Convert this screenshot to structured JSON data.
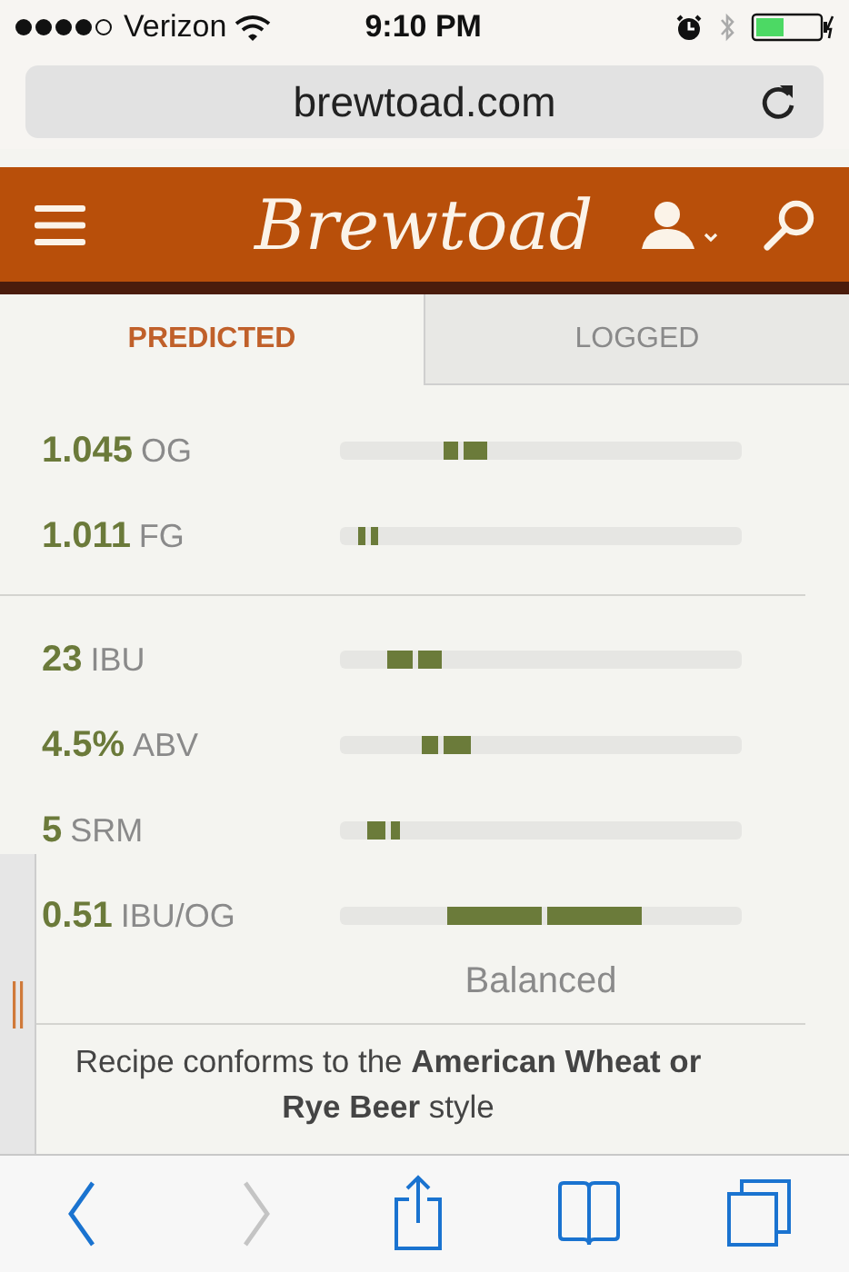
{
  "status_bar": {
    "carrier": "Verizon",
    "time": "9:10 PM"
  },
  "address_bar": {
    "url": "brewtoad.com"
  },
  "header": {
    "logo": "Brewtoad"
  },
  "tabs": [
    {
      "label": "PREDICTED",
      "selected": true
    },
    {
      "label": "LOGGED",
      "selected": false
    }
  ],
  "sections": [
    {
      "metrics": [
        {
          "value": "1.045",
          "unit": "OG",
          "low": {
            "level": 0.262
          },
          "mark": {
            "level": 0.303
          },
          "high": {
            "level": 0.362
          }
        },
        {
          "value": "1.011",
          "unit": "FG",
          "low": {
            "level": 0.05
          },
          "mark": {
            "level": 0.072
          },
          "high": {
            "level": 0.09
          }
        }
      ]
    },
    {
      "metrics": [
        {
          "value": "23",
          "unit": "IBU",
          "low": {
            "level": 0.122
          },
          "mark": {
            "level": 0.19
          },
          "high": {
            "level": 0.249
          }
        },
        {
          "value": "4.5%",
          "unit": "ABV",
          "low": {
            "level": 0.208
          },
          "mark": {
            "level": 0.249
          },
          "high": {
            "level": 0.321
          }
        },
        {
          "value": "5",
          "unit": "SRM",
          "low": {
            "level": 0.072
          },
          "mark": {
            "level": 0.118
          },
          "high": {
            "level": 0.145
          }
        },
        {
          "value": "0.51",
          "unit": "IBU/OG",
          "low": {
            "level": 0.271
          },
          "mark": {
            "level": 0.508
          },
          "high": {
            "level": 0.747
          },
          "caption": "Balanced"
        }
      ]
    }
  ],
  "note": {
    "text": "Recipe conforms to the **American Wheat or Rye Beer** style"
  },
  "toolbar": [
    {
      "kind": "back",
      "disabled": false
    },
    {
      "kind": "forward",
      "disabled": true
    },
    {
      "kind": "share",
      "disabled": false
    },
    {
      "kind": "bookmarks",
      "disabled": false
    },
    {
      "kind": "tabs",
      "disabled": false
    }
  ]
}
